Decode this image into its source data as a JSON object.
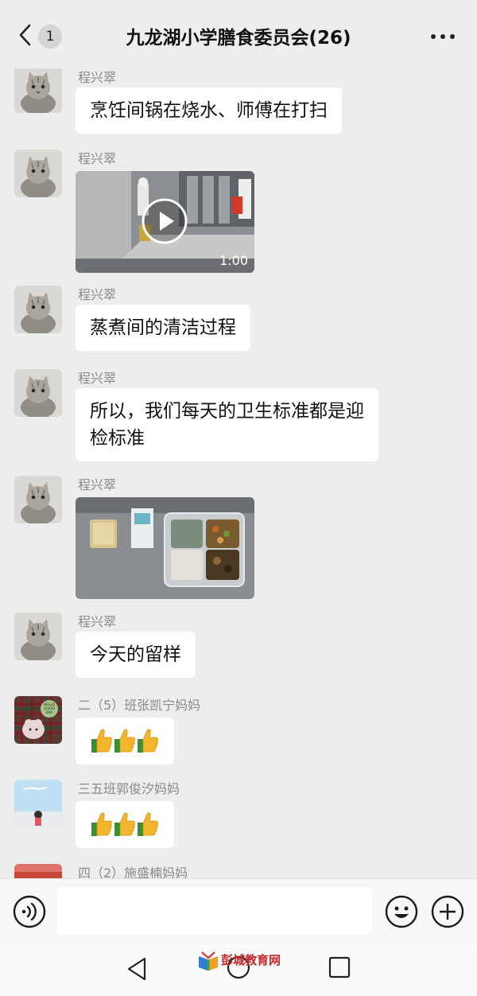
{
  "header": {
    "back_count": "1",
    "title": "九龙湖小学膳食委员会(26)"
  },
  "messages": [
    {
      "sender": "程兴翠",
      "text": "烹饪间锅在烧水、师傅在打扫"
    },
    {
      "sender": "程兴翠",
      "video_duration": "1:00"
    },
    {
      "sender": "程兴翠",
      "text": "蒸煮间的清洁过程"
    },
    {
      "sender": "程兴翠",
      "text_line1": "所以，我们每天的卫生标准都是迎",
      "text_line2": "检标准"
    },
    {
      "sender": "程兴翠"
    },
    {
      "sender": "程兴翠",
      "text": "今天的留样"
    },
    {
      "sender": "二（5）班张凯宁妈妈",
      "avatar_text1": "HELLO",
      "avatar_text2": "GOOD",
      "avatar_text3": "DAY"
    },
    {
      "sender": "三五班郭俊汐妈妈"
    },
    {
      "sender": "四（2）施盛楠妈妈"
    }
  ],
  "watermark": {
    "text": "彭城教育网"
  },
  "colors": {
    "background": "#ededed",
    "bubble": "#ffffff",
    "sender": "#8a8a8a",
    "watermark": "#c62828"
  },
  "icons": [
    "chevron-left-icon",
    "more-icon",
    "play-icon",
    "thumbs-up-icon",
    "voice-icon",
    "emoji-icon",
    "plus-icon",
    "nav-back-icon",
    "nav-home-icon",
    "nav-recent-icon"
  ]
}
